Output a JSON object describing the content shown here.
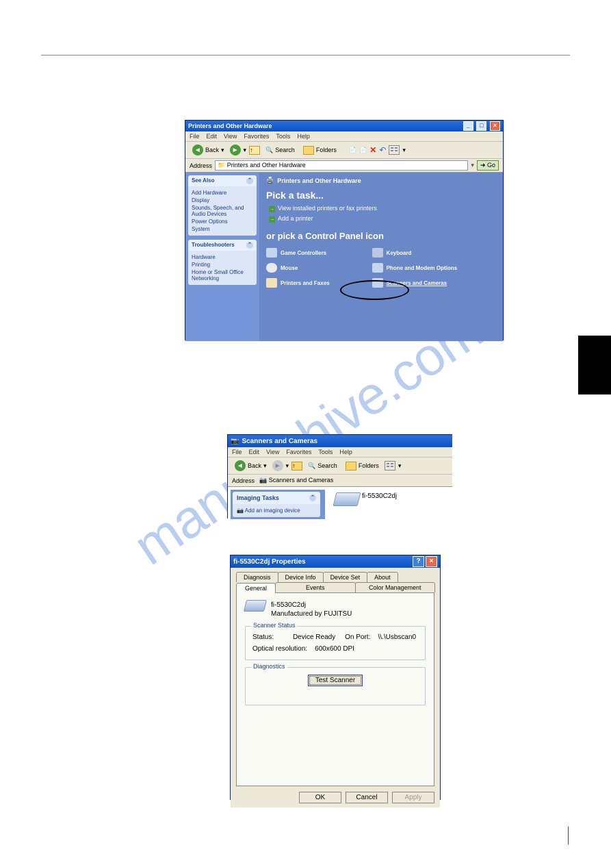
{
  "watermark": "manualshive.com",
  "win1": {
    "title": "Printers and Other Hardware",
    "menu": [
      "File",
      "Edit",
      "View",
      "Favorites",
      "Tools",
      "Help"
    ],
    "back": "Back",
    "search": "Search",
    "folders": "Folders",
    "addressLabel": "Address",
    "addressValue": "Printers and Other Hardware",
    "go": "Go",
    "seeAlso": {
      "head": "See Also",
      "items": [
        "Add Hardware",
        "Display",
        "Sounds, Speech, and Audio Devices",
        "Power Options",
        "System"
      ]
    },
    "troubleshoot": {
      "head": "Troubleshooters",
      "items": [
        "Hardware",
        "Printing",
        "Home or Small Office Networking"
      ]
    },
    "crumb": "Printers and Other Hardware",
    "taskHeading": "Pick a task...",
    "task1": "View installed printers or fax printers",
    "task2": "Add a printer",
    "orPick": "or pick a Control Panel icon",
    "cp": [
      "Game Controllers",
      "Keyboard",
      "Mouse",
      "Phone and Modem Options",
      "Printers and Faxes",
      "Scanners and Cameras"
    ]
  },
  "win2": {
    "title": "Scanners and Cameras",
    "menu": [
      "File",
      "Edit",
      "View",
      "Favorites",
      "Tools",
      "Help"
    ],
    "back": "Back",
    "search": "Search",
    "folders": "Folders",
    "addressLabel": "Address",
    "addressValue": "Scanners and Cameras",
    "tasksHead": "Imaging Tasks",
    "task1": "Add an imaging device",
    "deviceName": "fi-5530C2dj"
  },
  "win3": {
    "title": "fi-5530C2dj Properties",
    "tabsRow1": [
      "Diagnosis",
      "Device Info",
      "Device Set",
      "About"
    ],
    "tabsRow2": [
      "General",
      "Events",
      "Color Management"
    ],
    "model": "fi-5530C2dj",
    "mfr": "Manufactured by   FUJITSU",
    "scannerStatusLabel": "Scanner Status",
    "statusLabel": "Status:",
    "statusValue": "Device Ready",
    "onPortLabel": "On Port:",
    "onPortValue": "\\\\.\\Usbscan0",
    "opticalLabel": "Optical resolution:",
    "opticalValue": "600x600 DPI",
    "diagnosticsLabel": "Diagnostics",
    "testBtn": "Test Scanner",
    "ok": "OK",
    "cancel": "Cancel",
    "apply": "Apply"
  }
}
